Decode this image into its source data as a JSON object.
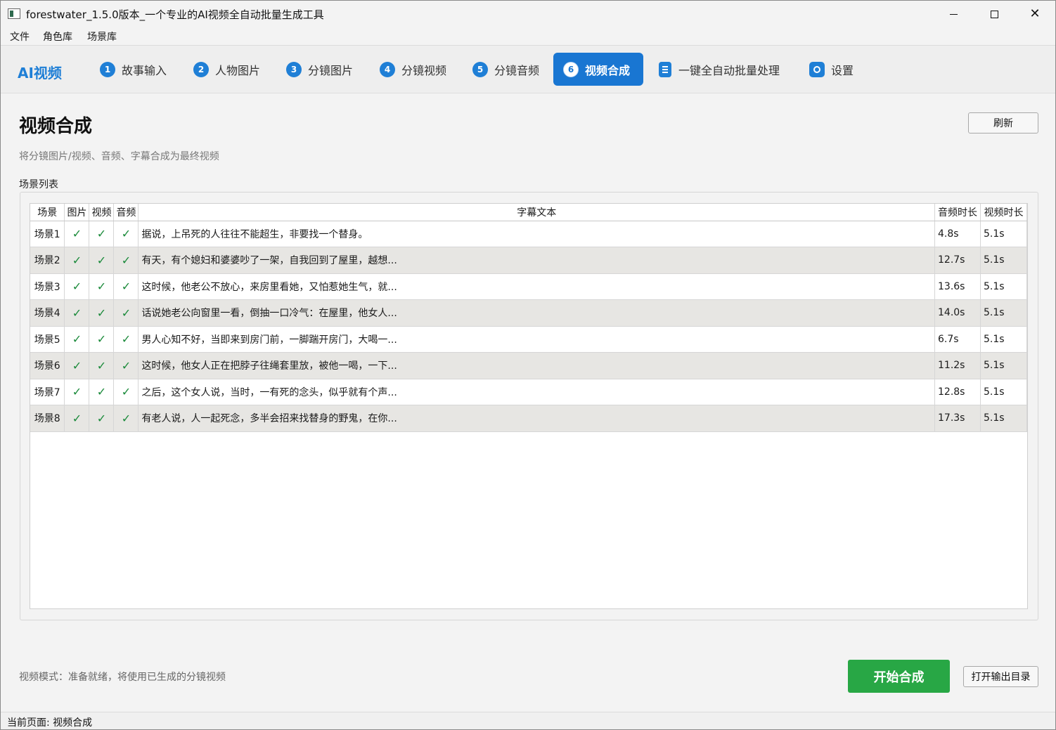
{
  "window": {
    "title": "forestwater_1.5.0版本_一个专业的AI视频全自动批量生成工具",
    "min_glyph": "",
    "close_glyph": "✕"
  },
  "menu": [
    "文件",
    "角色库",
    "场景库"
  ],
  "nav": {
    "brand": "AI视频",
    "tabs": [
      {
        "num": "1",
        "label": "故事输入",
        "active": false
      },
      {
        "num": "2",
        "label": "人物图片",
        "active": false
      },
      {
        "num": "3",
        "label": "分镜图片",
        "active": false
      },
      {
        "num": "4",
        "label": "分镜视频",
        "active": false
      },
      {
        "num": "5",
        "label": "分镜音频",
        "active": false
      },
      {
        "num": "6",
        "label": "视频合成",
        "active": true
      },
      {
        "num": "",
        "label": "一键全自动批量处理",
        "active": false,
        "icon": "document-icon"
      },
      {
        "num": "",
        "label": "设置",
        "active": false,
        "icon": "gear-icon"
      }
    ]
  },
  "page": {
    "title": "视频合成",
    "subtitle": "将分镜图片/视频、音频、字幕合成为最终视频",
    "refresh_label": "刷新",
    "group_label": "场景列表"
  },
  "table": {
    "headers": [
      "场景",
      "图片",
      "视频",
      "音频",
      "字幕文本",
      "音频时长",
      "视频时长"
    ],
    "check_glyph": "✓",
    "rows": [
      {
        "scene": "场景1",
        "image": "✓",
        "video": "✓",
        "audio": "✓",
        "text": "据说，上吊死的人往往不能超生，非要找一个替身。",
        "audio_len": "4.8s",
        "video_len": "5.1s"
      },
      {
        "scene": "场景2",
        "image": "✓",
        "video": "✓",
        "audio": "✓",
        "text": "有天，有个媳妇和婆婆吵了一架，自我回到了屋里，越想...",
        "audio_len": "12.7s",
        "video_len": "5.1s"
      },
      {
        "scene": "场景3",
        "image": "✓",
        "video": "✓",
        "audio": "✓",
        "text": "这时候，他老公不放心，来房里看她，又怕惹她生气，就...",
        "audio_len": "13.6s",
        "video_len": "5.1s"
      },
      {
        "scene": "场景4",
        "image": "✓",
        "video": "✓",
        "audio": "✓",
        "text": "话说她老公向窗里一看，倒抽一口冷气：在屋里，他女人...",
        "audio_len": "14.0s",
        "video_len": "5.1s"
      },
      {
        "scene": "场景5",
        "image": "✓",
        "video": "✓",
        "audio": "✓",
        "text": "男人心知不好，当即来到房门前，一脚踹开房门，大喝一...",
        "audio_len": "6.7s",
        "video_len": "5.1s"
      },
      {
        "scene": "场景6",
        "image": "✓",
        "video": "✓",
        "audio": "✓",
        "text": "这时候，他女人正在把脖子往绳套里放，被他一喝，一下...",
        "audio_len": "11.2s",
        "video_len": "5.1s"
      },
      {
        "scene": "场景7",
        "image": "✓",
        "video": "✓",
        "audio": "✓",
        "text": "之后，这个女人说，当时，一有死的念头，似乎就有个声...",
        "audio_len": "12.8s",
        "video_len": "5.1s"
      },
      {
        "scene": "场景8",
        "image": "✓",
        "video": "✓",
        "audio": "✓",
        "text": "有老人说，人一起死念，多半会招来找替身的野鬼，在你...",
        "audio_len": "17.3s",
        "video_len": "5.1s"
      }
    ]
  },
  "footer": {
    "mode_text": "视频模式：准备就绪，将使用已生成的分镜视频",
    "start_label": "开始合成",
    "open_dir_label": "打开输出目录",
    "status": "当前页面: 视频合成"
  },
  "colors": {
    "accent": "#1976d2",
    "start_button": "#28a745",
    "check": "#1a8a3a",
    "row_alt": "#e7e6e3"
  }
}
